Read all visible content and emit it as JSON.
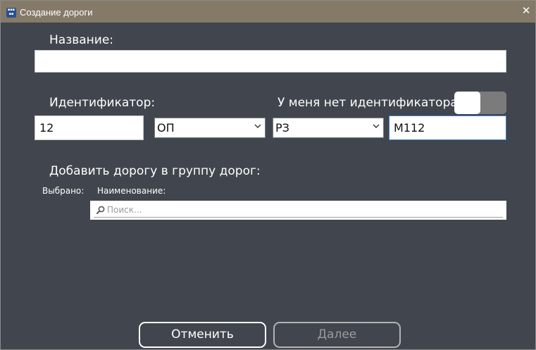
{
  "window": {
    "title": "Создание дороги",
    "close_icon": "close-icon",
    "app_icon": "app-logo-icon"
  },
  "name_field": {
    "label": "Название:",
    "value": ""
  },
  "identifier": {
    "label": "Идентификатор:",
    "number_value": "12",
    "type_select_value": "ОП",
    "region_select_value": "РЗ",
    "code_value": "М112"
  },
  "no_identifier_toggle": {
    "label": "У меня нет идентификатора",
    "state": "off"
  },
  "road_group": {
    "label": "Добавить дорогу в группу дорог:",
    "selected_label": "Выбрано:",
    "column_header": "Наименование:",
    "search_placeholder": "Поиск...",
    "search_icon": "search-icon"
  },
  "buttons": {
    "cancel_label": "Отменить",
    "next_label": "Далее",
    "next_enabled": false
  },
  "colors": {
    "background": "#41464e",
    "titlebar": "#857a68"
  }
}
